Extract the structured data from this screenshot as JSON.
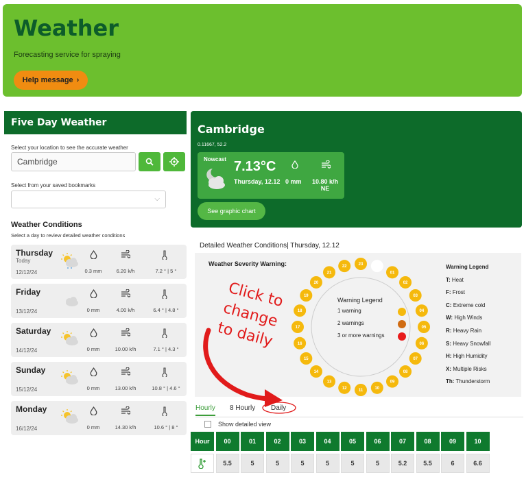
{
  "hero": {
    "title": "Weather",
    "subtitle": "Forecasting service for spraying",
    "help_label": "Help message",
    "help_chevron": "›"
  },
  "left": {
    "title": "Five Day Weather",
    "location_label": "Select your location to see the accurate weather",
    "location_value": "Cambridge",
    "bookmarks_label": "Select from your saved bookmarks",
    "conditions_title": "Weather Conditions",
    "conditions_sub": "Select a day to review detailed weather conditions",
    "days": [
      {
        "name": "Thursday",
        "sub": "Today",
        "date": "12/12/24",
        "rain": "0.3 mm",
        "wind": "6.20 k/h",
        "temp": "7.2 ° | 5 °"
      },
      {
        "name": "Friday",
        "sub": "",
        "date": "13/12/24",
        "rain": "0 mm",
        "wind": "4.00 k/h",
        "temp": "6.4 ° | 4.8 °"
      },
      {
        "name": "Saturday",
        "sub": "",
        "date": "14/12/24",
        "rain": "0 mm",
        "wind": "10.00 k/h",
        "temp": "7.1 ° | 4.3 °"
      },
      {
        "name": "Sunday",
        "sub": "",
        "date": "15/12/24",
        "rain": "0 mm",
        "wind": "13.00 k/h",
        "temp": "10.8 ° | 4.6 °"
      },
      {
        "name": "Monday",
        "sub": "",
        "date": "16/12/24",
        "rain": "0 mm",
        "wind": "14.30 k/h",
        "temp": "10.6 ° | 8 °"
      }
    ]
  },
  "right": {
    "city": "Cambridge",
    "coords": "0.11667, 52.2",
    "nowcast_label": "Nowcast",
    "temp": "7.13°C",
    "date": "Thursday, 12.12",
    "rain": "0 mm",
    "wind": "10.80 k/h",
    "wind_dir": "NE",
    "graph_btn": "See graphic chart"
  },
  "panel": {
    "title": "Detailed Weather Conditions| Thursday, 12.12",
    "severity_label": "Weather Severity Warning:",
    "center_legend_title": "Warning Legend",
    "center_legend": [
      {
        "label": "1 warning",
        "color": "#f5b90d"
      },
      {
        "label": "2 warnings",
        "color": "#d06c12"
      },
      {
        "label": "3 or more warnings",
        "color": "#e81b1b"
      }
    ],
    "legend_title": "Warning Legend",
    "legend": [
      {
        "code": "T:",
        "text": "Heat"
      },
      {
        "code": "F:",
        "text": "Frost"
      },
      {
        "code": "C:",
        "text": "Extreme cold"
      },
      {
        "code": "W:",
        "text": "High Winds"
      },
      {
        "code": "R:",
        "text": "Heavy Rain"
      },
      {
        "code": "S:",
        "text": "Heavy Snowfall"
      },
      {
        "code": "H:",
        "text": "High Humidity"
      },
      {
        "code": "X:",
        "text": "Multiple Risks"
      },
      {
        "code": "Th:",
        "text": "Thunderstorm"
      }
    ],
    "hours": [
      "23",
      "00",
      "01",
      "02",
      "03",
      "04",
      "05",
      "06",
      "07",
      "08",
      "09",
      "10",
      "11",
      "12",
      "13",
      "14",
      "15",
      "16",
      "17",
      "18",
      "19",
      "20",
      "21",
      "22"
    ],
    "annotation": "Click to change to daily"
  },
  "tabs": {
    "hourly": "Hourly",
    "eight": "8 Hourly",
    "daily": "Daily",
    "detailed": "Show detailed view"
  },
  "grid": {
    "head_label": "Hour",
    "hours": [
      "00",
      "01",
      "02",
      "03",
      "04",
      "05",
      "06",
      "07",
      "08",
      "09",
      "10"
    ],
    "values": [
      "5.5",
      "5",
      "5",
      "5",
      "5",
      "5",
      "5",
      "5.2",
      "5.5",
      "6",
      "6.6"
    ]
  }
}
